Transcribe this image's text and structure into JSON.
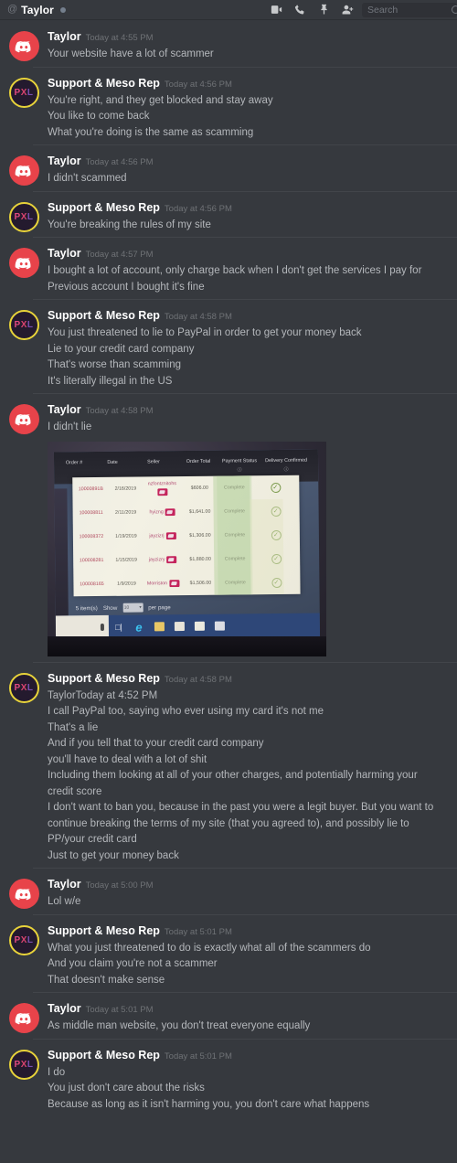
{
  "header": {
    "at_symbol": "@",
    "dm_name": "Taylor",
    "icons": [
      "video-camera-icon",
      "phone-icon",
      "pin-icon",
      "add-person-icon"
    ],
    "search_placeholder": "Search"
  },
  "colors": {
    "app_bg": "#36393e",
    "author_name": "#ffffff",
    "message_text": "#b4b7bb",
    "timestamp": "#6f7276",
    "taylor_avatar": "#e8434a",
    "pxl_ring": "#e8d33a"
  },
  "messages": [
    {
      "author": "Taylor",
      "avatar": "discord-logo-avatar",
      "timestamp": "Today at 4:55 PM",
      "lines": [
        "Your website have a lot of scammer"
      ]
    },
    {
      "author": "Support & Meso Rep",
      "avatar": "pxl-avatar",
      "timestamp": "Today at 4:56 PM",
      "lines": [
        "You're right, and they get blocked and stay away",
        "You like to come back",
        "What you're doing is the same as scamming"
      ]
    },
    {
      "author": "Taylor",
      "avatar": "discord-logo-avatar",
      "timestamp": "Today at 4:56 PM",
      "lines": [
        "I didn't scammed"
      ]
    },
    {
      "author": "Support & Meso Rep",
      "avatar": "pxl-avatar",
      "timestamp": "Today at 4:56 PM",
      "lines": [
        "You're breaking the rules of my site"
      ]
    },
    {
      "author": "Taylor",
      "avatar": "discord-logo-avatar",
      "timestamp": "Today at 4:57 PM",
      "lines": [
        "I bought a lot of account, only charge back when I don't get the services I pay for",
        "Previous account I bought it's fine"
      ]
    },
    {
      "author": "Support & Meso Rep",
      "avatar": "pxl-avatar",
      "timestamp": "Today at 4:58 PM",
      "lines": [
        "You just threatened to lie to PayPal in order to get your money back",
        "Lie to your credit card company",
        "That's worse than scamming",
        "It's literally illegal in the US"
      ]
    },
    {
      "author": "Taylor",
      "avatar": "discord-logo-avatar",
      "timestamp": "Today at 4:58 PM",
      "lines": [
        "I didn't lie"
      ],
      "attachment": "order-history-photo"
    },
    {
      "author": "Support & Meso Rep",
      "avatar": "pxl-avatar",
      "timestamp": "Today at 4:58 PM",
      "lines": [
        "TaylorToday at 4:52 PM",
        "I call PayPal too, saying who ever using my card it's not me",
        "That's a lie",
        "And if you tell that to your credit card company",
        "you'll have to deal with a lot of shit",
        "Including them looking at all of your other charges, and potentially harming your credit score",
        "I don't want to ban you, because in the past you were a legit buyer. But you want to continue breaking the terms of my site (that you agreed to), and possibly lie to PP/your credit card",
        "Just to get your money back"
      ]
    },
    {
      "author": "Taylor",
      "avatar": "discord-logo-avatar",
      "timestamp": "Today at 5:00 PM",
      "lines": [
        "Lol w/e"
      ]
    },
    {
      "author": "Support & Meso Rep",
      "avatar": "pxl-avatar",
      "timestamp": "Today at 5:01 PM",
      "lines": [
        "What you just threatened to do is exactly what all of the scammers do",
        "And you claim you're not a scammer",
        "That doesn't make sense"
      ]
    },
    {
      "author": "Taylor",
      "avatar": "discord-logo-avatar",
      "timestamp": "Today at 5:01 PM",
      "lines": [
        "As middle man website, you don't treat everyone equally"
      ]
    },
    {
      "author": "Support & Meso Rep",
      "avatar": "pxl-avatar",
      "timestamp": "Today at 5:01 PM",
      "lines": [
        "I do",
        "You just don't care about the risks",
        "Because as long as it isn't harming you, you don't care what happens"
      ]
    }
  ],
  "attachment": {
    "name": "order-history-photo",
    "description": "photo of a monitor showing an order history table",
    "table": {
      "headers": [
        "Order #",
        "Date",
        "Seller",
        "Order Total",
        "Payment Status",
        "Delivery Confirmed"
      ],
      "rows": [
        {
          "order": "10000891B",
          "date": "2/16/2019",
          "seller": "nzfontznitohs",
          "total": "$606.00",
          "status": "Complete",
          "confirmed": "check"
        },
        {
          "order": "100008811",
          "date": "2/11/2019",
          "seller": "hyizng",
          "total": "$1,641.00",
          "status": "Complete",
          "confirmed": "check"
        },
        {
          "order": "100008372",
          "date": "1/19/2019",
          "seller": "jayzizrj",
          "total": "$1,306.00",
          "status": "Complete",
          "confirmed": "check"
        },
        {
          "order": "100008281",
          "date": "1/15/2019",
          "seller": "jayzizry",
          "total": "$1,880.00",
          "status": "Complete",
          "confirmed": "check"
        },
        {
          "order": "100008165",
          "date": "1/9/2019",
          "seller": "Morriston",
          "total": "$1,506.00",
          "status": "Complete",
          "confirmed": "check"
        }
      ],
      "footer": {
        "count_label": "5 item(s)",
        "show_label": "Show",
        "per_page_value": "10",
        "per_page_label": "per page"
      }
    },
    "taskbar_icons": [
      "cortana-mic-icon",
      "task-view-icon",
      "edge-icon",
      "file-explorer-icon",
      "store-icon",
      "mail-icon",
      "calculator-icon"
    ]
  }
}
